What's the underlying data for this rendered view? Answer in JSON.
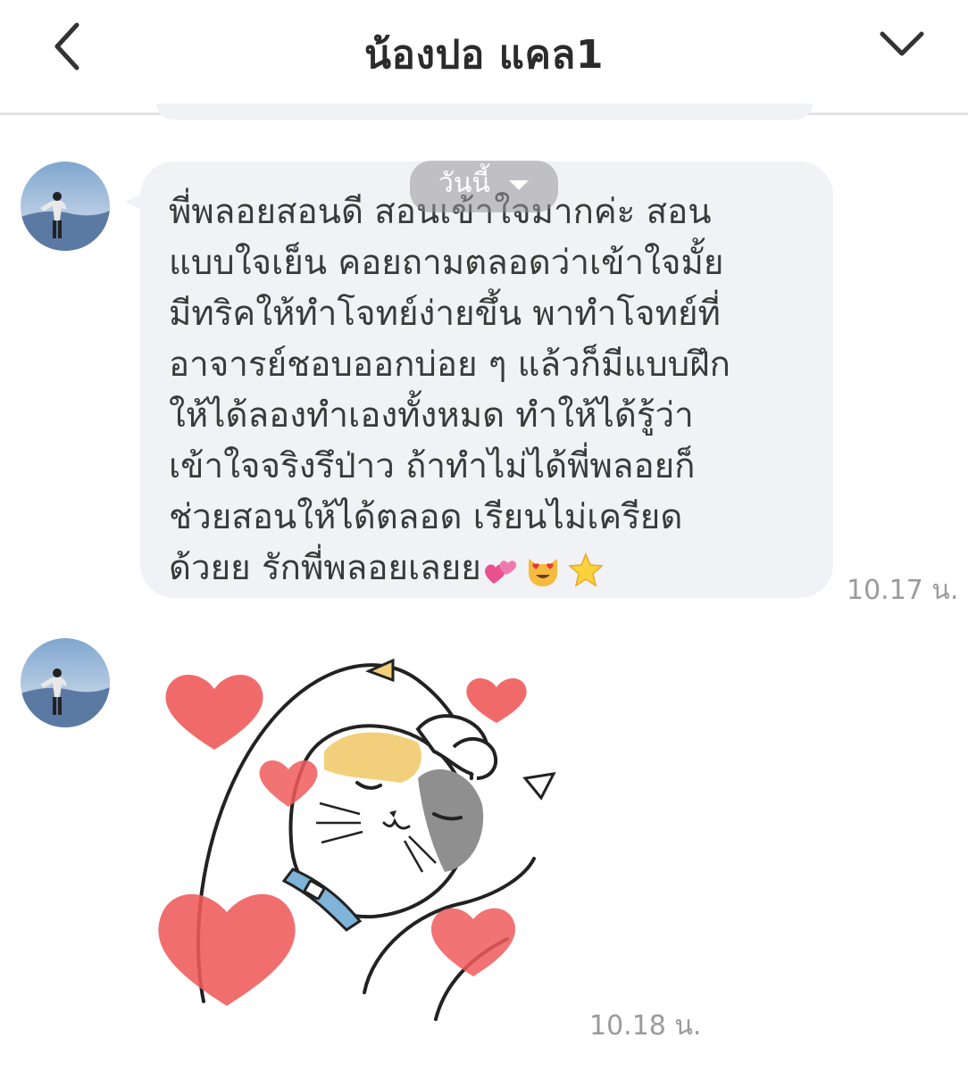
{
  "header": {
    "title": "น้องปอ แคล1",
    "back_icon": "chevron-left-icon",
    "menu_icon": "chevron-down-icon"
  },
  "date_separator": {
    "label": "วันนี้"
  },
  "messages": [
    {
      "type": "text",
      "text": "พี่พลอยสอนดี สอนเข้าใจมากค่ะ สอน\nแบบใจเย็น คอยถามตลอดว่าเข้าใจมั้ย\nมีทริคให้ทำโจทย์ง่ายขึ้น พาทำโจทย์ที่\nอาจารย์ชอบออกบ่อย ๆ แล้วก็มีแบบฝึก\nให้ได้ลองทำเองทั้งหมด ทำให้ได้รู้ว่า\nเข้าใจจริงรึป่าว ถ้าทำไม่ได้พี่พลอยก็\nช่วยสอนให้ได้ตลอด เรียนไม่เครียด\nด้วยย รักพี่พลอยเลยย",
      "emojis": [
        "two-hearts-emoji",
        "heart-eyes-cat-emoji",
        "star-emoji"
      ],
      "time": "10.17 น."
    },
    {
      "type": "sticker",
      "sticker": "cat-hugging-with-hearts-sticker",
      "time": "10.18 น."
    }
  ],
  "colors": {
    "bubble": "#f1f2f5",
    "timestamp": "#9a9a9f",
    "heart": "#ef5a5a"
  }
}
